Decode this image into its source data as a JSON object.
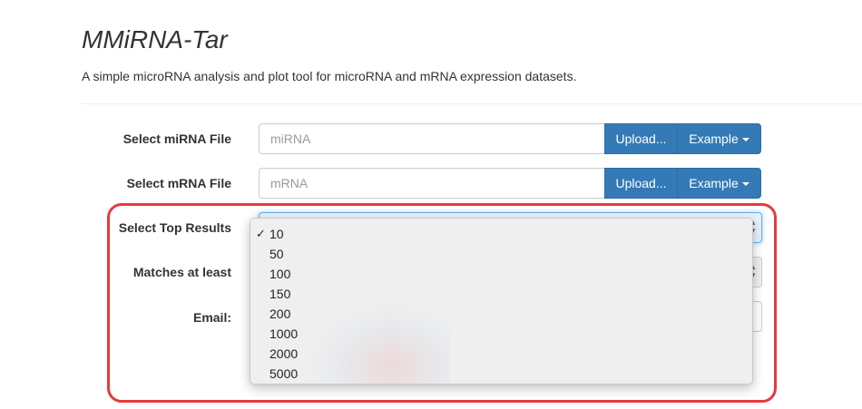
{
  "header": {
    "title": "MMiRNA-Tar",
    "subtitle": "A simple microRNA analysis and plot tool for microRNA and mRNA expression datasets."
  },
  "form": {
    "mirna": {
      "label": "Select miRNA File",
      "placeholder": "miRNA",
      "upload_label": "Upload...",
      "example_label": "Example"
    },
    "mrna": {
      "label": "Select mRNA File",
      "placeholder": "mRNA",
      "upload_label": "Upload...",
      "example_label": "Example"
    },
    "top_results": {
      "label": "Select Top Results",
      "selected": "10",
      "options": [
        "10",
        "50",
        "100",
        "150",
        "200",
        "1000",
        "2000",
        "5000"
      ]
    },
    "matches": {
      "label": "Matches at least"
    },
    "email": {
      "label": "Email:"
    }
  },
  "colors": {
    "primary_button": "#337ab7",
    "annotation_outline": "#e8393e"
  },
  "icons": {
    "check": "✓",
    "select_arrows": "updown-arrows-icon",
    "caret": "caret-down-icon"
  }
}
